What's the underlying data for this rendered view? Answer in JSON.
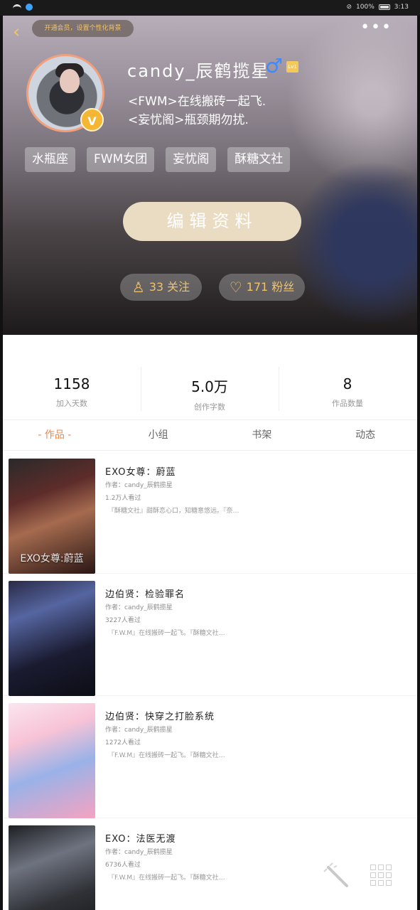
{
  "status_bar": {
    "battery_text": "100%",
    "time": "3:13"
  },
  "header": {
    "vip_banner": "开通会员，设置个性化背景",
    "username": "candy_辰鹤揽星",
    "gender_symbol": "♂",
    "level_badge": "Lv1",
    "avatar_badge": "V",
    "bio": "<FWM>在线搬砖一起飞.\n<妄忧阁>瓶颈期勿扰.",
    "tags": [
      "水瓶座",
      "FWM女团",
      "妄忧阁",
      "酥糖文社"
    ],
    "edit_button": "编辑资料",
    "follow_label": "33 关注",
    "fans_label": "171 粉丝"
  },
  "stats": [
    {
      "value": "1158",
      "label": "加入天数"
    },
    {
      "value": "5.0万",
      "label": "创作字数"
    },
    {
      "value": "8",
      "label": "作品数量"
    }
  ],
  "tabs": [
    {
      "label": "- 作品 -",
      "active": true
    },
    {
      "label": "小组",
      "active": false
    },
    {
      "label": "书架",
      "active": false
    },
    {
      "label": "动态",
      "active": false
    }
  ],
  "works": [
    {
      "title": "EXO女尊：蔚蓝",
      "author": "作者：candy_辰鹤揽星",
      "views": "1.2万人看过",
      "snippet": "『酥糖文社』甜酥恋心口，知糖意悠远。『奈…",
      "cover_text": "EXO女尊:蔚蓝"
    },
    {
      "title": "边伯贤：检验罪名",
      "author": "作者：candy_辰鹤揽星",
      "views": "3227人看过",
      "snippet": "『F.W.M』在线搬砖一起飞。『酥糖文社…",
      "cover_text": ""
    },
    {
      "title": "边伯贤：快穿之打脸系统",
      "author": "作者：candy_辰鹤揽星",
      "views": "1272人看过",
      "snippet": "『F.W.M』在线搬砖一起飞。『酥糖文社…",
      "cover_text": ""
    },
    {
      "title": "EXO：法医无渡",
      "author": "作者：candy_辰鹤揽星",
      "views": "6736人看过",
      "snippet": "『F.W.M』在线搬砖一起飞。『酥糖文社…",
      "cover_text": ""
    }
  ]
}
